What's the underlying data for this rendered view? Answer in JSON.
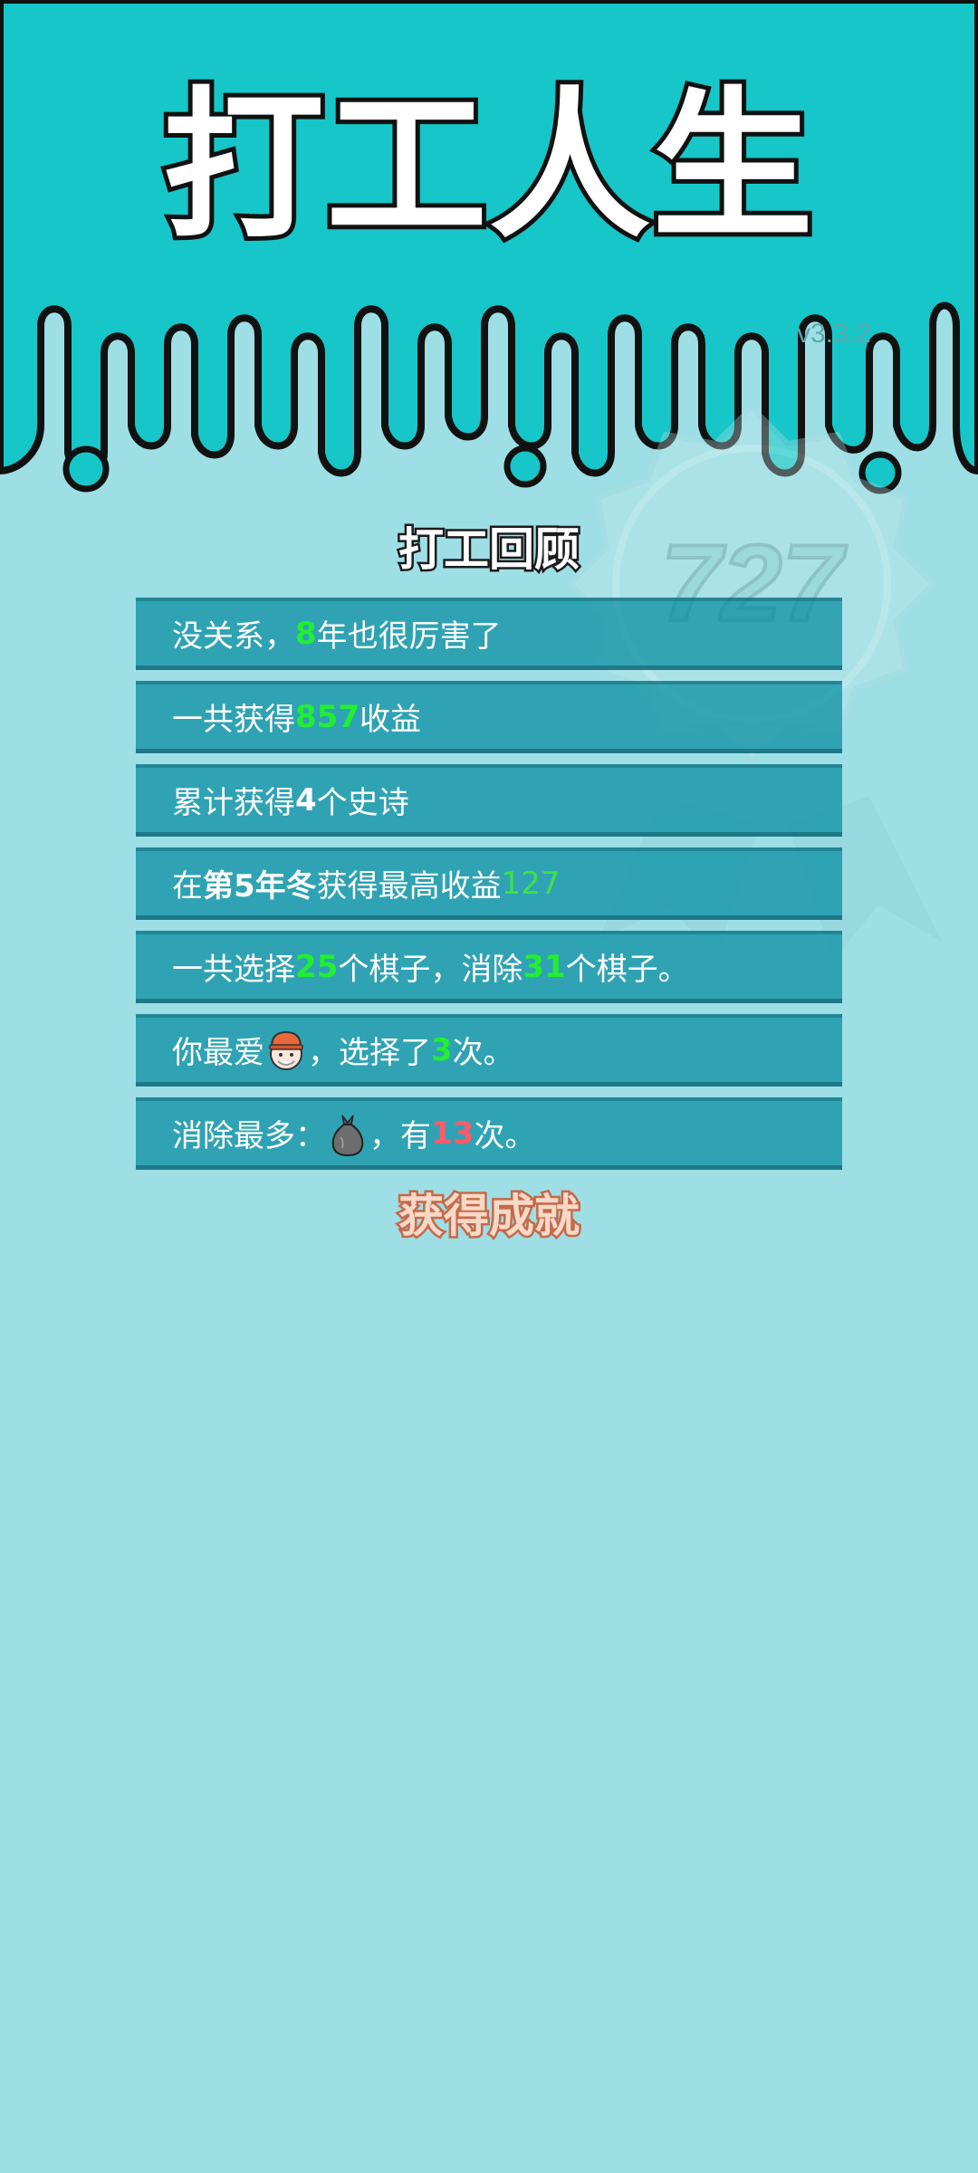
{
  "app": {
    "title": "打工人生",
    "version": "v3.3.2",
    "watermark_number": "727"
  },
  "colors": {
    "header_teal": "#17c6c8",
    "background": "#9edfe6",
    "row_bg": "#0a9bb0",
    "highlight_green": "#22ee33",
    "highlight_red": "#ff5a6a",
    "achievement_title": "#f8d9c8"
  },
  "review": {
    "title": "打工回顾",
    "rows": [
      {
        "pre": "没关系，",
        "value": "8",
        "post": "年也很厉害了"
      },
      {
        "pre": "一共获得",
        "value": "857",
        "post": "收益"
      },
      {
        "pre": "累计获得",
        "value": "4",
        "post": "个史诗"
      },
      {
        "pre": "在 ",
        "bold": "第5年冬",
        "mid": " 获得最高收益",
        "value": "127"
      },
      {
        "pre": "一共选择",
        "value": "25",
        "mid": "个棋子，消除",
        "value2": "31",
        "post": "个棋子。"
      },
      {
        "pre": "你最爱",
        "icon": "worker-face-icon",
        "mid": "，选择了",
        "value": "3",
        "post": "次。"
      },
      {
        "pre": "消除最多：",
        "icon": "garbage-bag-icon",
        "mid": "，有",
        "value": "13",
        "post": "次。"
      }
    ]
  },
  "achievements": {
    "title": "获得成就"
  }
}
